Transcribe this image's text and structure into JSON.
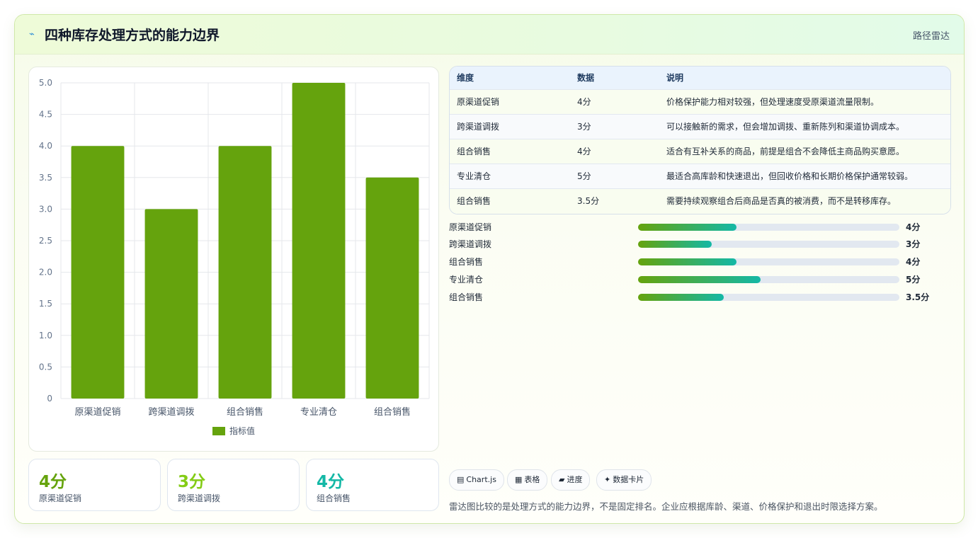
{
  "header": {
    "icon": "lightning-icon",
    "title": "四种库存处理方式的能力边界",
    "nav_label": "路径雷达"
  },
  "chart_data": {
    "type": "bar",
    "categories": [
      "原渠道促销",
      "跨渠道调拨",
      "组合销售",
      "专业清仓",
      "组合销售"
    ],
    "series": [
      {
        "name": "指标值",
        "values": [
          4,
          3,
          4,
          5,
          3.5
        ],
        "color": "#65a30d"
      }
    ],
    "ylim": [
      0,
      5
    ],
    "yticks": [
      "0",
      "0.5",
      "1.0",
      "1.5",
      "2.0",
      "2.5",
      "3.0",
      "3.5",
      "4.0",
      "4.5",
      "5.0"
    ],
    "grid": true,
    "legend_position": "bottom"
  },
  "stats": [
    {
      "value": "4分",
      "label": "原渠道促销",
      "color": "#65a30d"
    },
    {
      "value": "3分",
      "label": "跨渠道调拨",
      "color": "#84cc16"
    },
    {
      "value": "4分",
      "label": "组合销售",
      "color": "#14b8a6"
    }
  ],
  "table": {
    "headers": [
      "维度",
      "数据",
      "说明"
    ],
    "rows": [
      {
        "dim": "原渠道促销",
        "data": "4分",
        "desc": "价格保护能力相对较强，但处理速度受原渠道流量限制。"
      },
      {
        "dim": "跨渠道调拨",
        "data": "3分",
        "desc": "可以接触新的需求，但会增加调拨、重新陈列和渠道协调成本。"
      },
      {
        "dim": "组合销售",
        "data": "4分",
        "desc": "适合有互补关系的商品，前提是组合不会降低主商品购买意愿。"
      },
      {
        "dim": "专业清仓",
        "data": "5分",
        "desc": "最适合高库龄和快速退出，但回收价格和长期价格保护通常较弱。"
      },
      {
        "dim": "组合销售",
        "data": "3.5分",
        "desc": "需要持续观察组合后商品是否真的被消费，而不是转移库存。"
      }
    ]
  },
  "progress": [
    {
      "label": "原渠道促销",
      "value_text": "4分",
      "fraction": 0.376
    },
    {
      "label": "跨渠道调拨",
      "value_text": "3分",
      "fraction": 0.282
    },
    {
      "label": "组合销售",
      "value_text": "4分",
      "fraction": 0.376
    },
    {
      "label": "专业清仓",
      "value_text": "5分",
      "fraction": 0.47
    },
    {
      "label": "组合销售",
      "value_text": "3.5分",
      "fraction": 0.329
    }
  ],
  "tags": [
    {
      "icon": "chart-icon",
      "glyph": "▤",
      "label": "Chart.js"
    },
    {
      "icon": "table-icon",
      "glyph": "▦",
      "label": "表格"
    },
    {
      "icon": "folder-icon",
      "glyph": "▰",
      "label": "进度"
    },
    {
      "icon": "sparkle-icon",
      "glyph": "✦",
      "label": "数据卡片"
    }
  ],
  "note": "雷达图比较的是处理方式的能力边界，不是固定排名。企业应根据库龄、渠道、价格保护和退出时限选择方案。"
}
